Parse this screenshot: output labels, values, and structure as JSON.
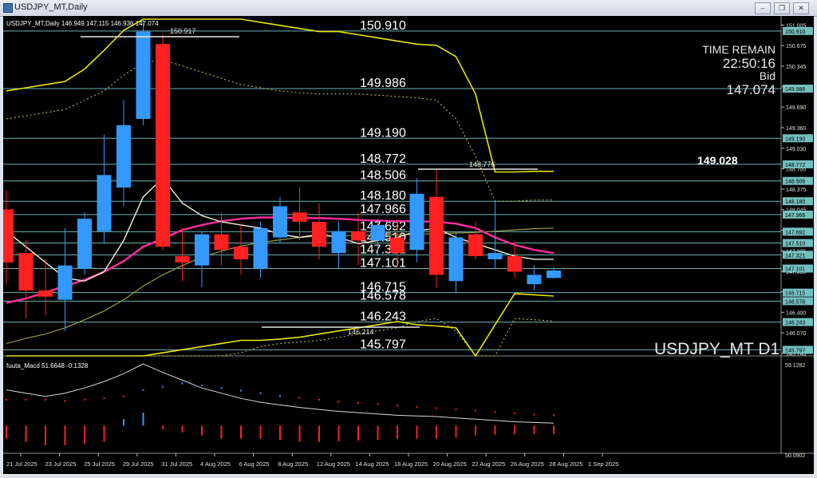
{
  "window": {
    "title": "USDJPY_MT,Daily",
    "colors": {
      "chrome": "#dfe5ee",
      "background": "#000000",
      "bull": "#3399ff",
      "bear": "#ff2020",
      "level_line": "#7fd4d4",
      "envelope": "#e6e600",
      "ma_fast": "#f5f0d8",
      "ma_mid": "#ff2da0",
      "ma_slow": "#9b9b3c"
    },
    "icons": [
      "app-icon",
      "minimize-icon",
      "restore-icon",
      "close-icon"
    ]
  },
  "header": {
    "info_line": "USDJPY_MT,Daily  146.949 147.115 146.936 147.074"
  },
  "panel": {
    "time_remain_label": "TIME REMAIN",
    "time_remain": "22:50:16",
    "bid_label": "Bid",
    "bid": "147.074",
    "highlight_value": "149.028",
    "watermark": "USDJPY_MT D1"
  },
  "annotations": {
    "high_label": "150.917",
    "mid_high_label": "148.776",
    "low_label": "146.214"
  },
  "levels": [
    {
      "value": 150.91,
      "label": "150.910"
    },
    {
      "value": 149.986,
      "label": "149.986"
    },
    {
      "value": 149.19,
      "label": "149.190"
    },
    {
      "value": 148.772,
      "label": "148.772"
    },
    {
      "value": 148.506,
      "label": "148.506"
    },
    {
      "value": 148.18,
      "label": "148.180"
    },
    {
      "value": 147.966,
      "label": "147.966"
    },
    {
      "value": 147.692,
      "label": "147.692"
    },
    {
      "value": 147.51,
      "label": "147.510"
    },
    {
      "value": 147.321,
      "label": "147.321"
    },
    {
      "value": 147.101,
      "label": "147.101"
    },
    {
      "value": 146.715,
      "label": "146.715"
    },
    {
      "value": 146.578,
      "label": "146.578"
    },
    {
      "value": 146.243,
      "label": "146.243"
    },
    {
      "value": 145.797,
      "label": "145.797"
    }
  ],
  "price_axis": {
    "ticks": [
      "151.005",
      "150.675",
      "150.345",
      "150.015",
      "149.690",
      "149.360",
      "149.030",
      "148.700",
      "148.375",
      "148.045",
      "147.715",
      "147.385",
      "147.055",
      "146.730",
      "146.400",
      "146.070",
      "145.740"
    ],
    "tags": [
      "150.910",
      "149.986",
      "149.190",
      "148.772",
      "148.506",
      "148.180",
      "147.966",
      "147.692",
      "147.510",
      "147.321",
      "147.101",
      "146.715",
      "146.578",
      "146.243",
      "145.797"
    ],
    "min": 145.7,
    "max": 151.1
  },
  "macd": {
    "label": "fuuta_Macd 51.6648 -0.1328",
    "top_tick": "59.1282",
    "bottom_tick": "50.0902"
  },
  "date_axis": [
    "21 Jul 2025",
    "23 Jul 2025",
    "25 Jul 2025",
    "29 Jul 2025",
    "31 Jul 2025",
    "4 Aug 2025",
    "6 Aug 2025",
    "8 Aug 2025",
    "12 Aug 2025",
    "14 Aug 2025",
    "18 Aug 2025",
    "20 Aug 2025",
    "22 Aug 2025",
    "26 Aug 2025",
    "28 Aug 2025",
    "1 Sep 2025"
  ],
  "chart_data": {
    "type": "candlestick",
    "symbol": "USDJPY_MT",
    "timeframe": "Daily",
    "candles": [
      {
        "o": 148.05,
        "h": 148.35,
        "l": 146.85,
        "c": 147.2
      },
      {
        "o": 147.35,
        "h": 147.55,
        "l": 146.3,
        "c": 146.75
      },
      {
        "o": 146.75,
        "h": 147.25,
        "l": 146.35,
        "c": 146.65
      },
      {
        "o": 146.6,
        "h": 147.75,
        "l": 146.1,
        "c": 147.15
      },
      {
        "o": 147.1,
        "h": 148.0,
        "l": 147.0,
        "c": 147.9
      },
      {
        "o": 147.7,
        "h": 149.25,
        "l": 147.5,
        "c": 148.6
      },
      {
        "o": 148.4,
        "h": 149.8,
        "l": 148.1,
        "c": 149.4
      },
      {
        "o": 149.5,
        "h": 151.1,
        "l": 149.4,
        "c": 150.9
      },
      {
        "o": 150.7,
        "h": 150.85,
        "l": 147.4,
        "c": 147.45
      },
      {
        "o": 147.3,
        "h": 147.75,
        "l": 146.9,
        "c": 147.2
      },
      {
        "o": 147.15,
        "h": 147.7,
        "l": 146.8,
        "c": 147.65
      },
      {
        "o": 147.65,
        "h": 148.0,
        "l": 147.15,
        "c": 147.4
      },
      {
        "o": 147.45,
        "h": 147.8,
        "l": 147.0,
        "c": 147.25
      },
      {
        "o": 147.1,
        "h": 147.85,
        "l": 146.95,
        "c": 147.75
      },
      {
        "o": 147.6,
        "h": 148.25,
        "l": 147.5,
        "c": 148.1
      },
      {
        "o": 148.0,
        "h": 148.4,
        "l": 147.55,
        "c": 147.85
      },
      {
        "o": 147.85,
        "h": 148.15,
        "l": 147.25,
        "c": 147.45
      },
      {
        "o": 147.35,
        "h": 147.85,
        "l": 147.1,
        "c": 147.7
      },
      {
        "o": 147.7,
        "h": 148.0,
        "l": 147.15,
        "c": 147.55
      },
      {
        "o": 147.55,
        "h": 147.9,
        "l": 147.3,
        "c": 147.8
      },
      {
        "o": 147.6,
        "h": 147.9,
        "l": 147.1,
        "c": 147.35
      },
      {
        "o": 147.4,
        "h": 148.55,
        "l": 147.2,
        "c": 148.3
      },
      {
        "o": 148.25,
        "h": 148.7,
        "l": 146.8,
        "c": 147.0
      },
      {
        "o": 146.9,
        "h": 147.7,
        "l": 146.7,
        "c": 147.6
      },
      {
        "o": 147.65,
        "h": 147.85,
        "l": 147.25,
        "c": 147.3
      },
      {
        "o": 147.25,
        "h": 148.2,
        "l": 147.1,
        "c": 147.35
      },
      {
        "o": 147.3,
        "h": 147.55,
        "l": 146.95,
        "c": 147.05
      },
      {
        "o": 146.85,
        "h": 147.15,
        "l": 146.75,
        "c": 147.0
      },
      {
        "o": 146.95,
        "h": 147.12,
        "l": 146.94,
        "c": 147.07
      }
    ],
    "ma_fast": [
      147.7,
      147.45,
      147.2,
      146.95,
      146.9,
      147.05,
      147.55,
      148.25,
      148.55,
      148.15,
      147.95,
      147.85,
      147.8,
      147.75,
      147.65,
      147.6,
      147.65,
      147.6,
      147.5,
      147.55,
      147.6,
      147.7,
      147.75,
      147.6,
      147.5,
      147.4,
      147.3,
      147.25,
      147.25
    ],
    "ma_mid": [
      146.55,
      146.62,
      146.72,
      146.82,
      146.92,
      147.05,
      147.22,
      147.45,
      147.58,
      147.72,
      147.8,
      147.86,
      147.9,
      147.92,
      147.92,
      147.91,
      147.91,
      147.9,
      147.88,
      147.87,
      147.86,
      147.86,
      147.85,
      147.82,
      147.75,
      147.6,
      147.48,
      147.4,
      147.35
    ],
    "ma_slow": [
      145.9,
      145.98,
      146.05,
      146.15,
      146.28,
      146.42,
      146.6,
      146.82,
      147.0,
      147.15,
      147.28,
      147.38,
      147.46,
      147.52,
      147.56,
      147.6,
      147.62,
      147.63,
      147.63,
      147.64,
      147.64,
      147.65,
      147.66,
      147.67,
      147.68,
      147.7,
      147.72,
      147.74,
      147.75
    ],
    "envelope_upper": [
      149.95,
      150.0,
      150.05,
      150.1,
      150.3,
      150.6,
      150.92,
      151.3,
      151.4,
      151.3,
      151.2,
      151.15,
      151.1,
      151.05,
      151.0,
      150.95,
      150.9,
      150.9,
      150.85,
      150.8,
      150.75,
      150.7,
      150.68,
      150.5,
      149.9,
      148.65,
      148.65,
      148.66,
      148.66
    ],
    "envelope_lower": [
      145.0,
      145.05,
      145.1,
      145.15,
      145.25,
      145.35,
      145.5,
      145.65,
      145.75,
      145.8,
      145.85,
      145.9,
      145.95,
      145.95,
      145.97,
      146.0,
      146.05,
      146.1,
      146.15,
      146.2,
      146.25,
      146.2,
      146.18,
      146.15,
      145.6,
      146.2,
      146.7,
      146.68,
      146.66
    ],
    "envelope_upper2": [
      149.5,
      149.55,
      149.6,
      149.65,
      149.8,
      149.95,
      150.2,
      150.4,
      150.45,
      150.35,
      150.25,
      150.15,
      150.05,
      150.0,
      149.95,
      149.92,
      149.9,
      149.9,
      149.9,
      149.88,
      149.86,
      149.84,
      149.8,
      149.5,
      148.9,
      148.18,
      148.18,
      148.2,
      148.2
    ],
    "envelope_lower2": [
      144.5,
      144.55,
      144.6,
      144.7,
      144.85,
      145.0,
      145.15,
      145.3,
      145.4,
      145.45,
      145.55,
      145.65,
      145.75,
      145.85,
      145.9,
      145.92,
      145.95,
      146.0,
      146.05,
      146.1,
      146.15,
      146.25,
      146.3,
      146.1,
      145.2,
      145.3,
      146.3,
      146.28,
      146.26
    ],
    "macd_line": [
      0.55,
      0.5,
      0.45,
      0.5,
      0.58,
      0.68,
      0.8,
      0.95,
      0.82,
      0.7,
      0.58,
      0.5,
      0.42,
      0.36,
      0.32,
      0.28,
      0.25,
      0.22,
      0.2,
      0.18,
      0.16,
      0.15,
      0.14,
      0.12,
      0.1,
      0.08,
      0.06,
      0.05,
      0.04
    ],
    "macd_hist": [
      -0.2,
      -0.25,
      -0.3,
      -0.3,
      -0.28,
      -0.25,
      0.1,
      0.2,
      -0.05,
      -0.1,
      -0.15,
      -0.2,
      -0.2,
      -0.2,
      -0.22,
      -0.25,
      -0.25,
      -0.24,
      -0.23,
      -0.22,
      -0.2,
      -0.2,
      -0.2,
      -0.18,
      -0.15,
      -0.14,
      -0.13,
      -0.13,
      -0.13
    ],
    "macd_signal": [
      0.4,
      0.4,
      0.4,
      0.38,
      0.4,
      0.42,
      0.45,
      0.55,
      0.6,
      0.65,
      0.62,
      0.58,
      0.54,
      0.5,
      0.46,
      0.43,
      0.4,
      0.37,
      0.35,
      0.33,
      0.31,
      0.29,
      0.27,
      0.25,
      0.23,
      0.21,
      0.19,
      0.17,
      0.16
    ]
  }
}
